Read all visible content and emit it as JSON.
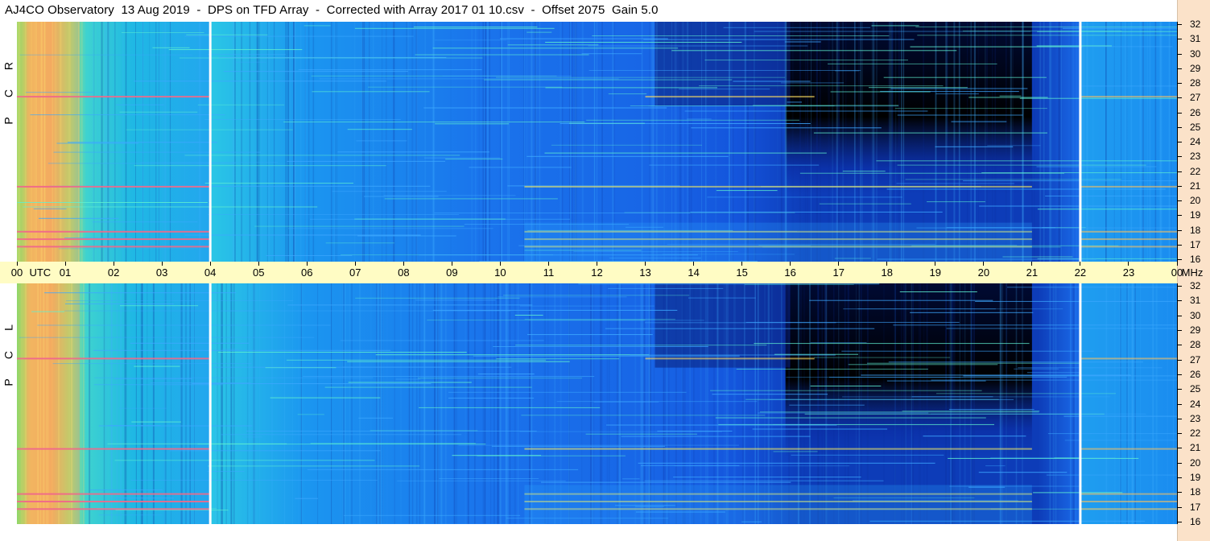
{
  "title": "AJ4CO Observatory  13 Aug 2019  -  DPS on TFD Array  -  Corrected with Array 2017 01 10.csv  -  Offset 2075  Gain 5.0",
  "panels": [
    {
      "id": "rcp",
      "label": "R C P",
      "letters": [
        "R",
        "C",
        "P"
      ]
    },
    {
      "id": "lcp",
      "label": "L C P",
      "letters": [
        "L",
        "C",
        "P"
      ]
    }
  ],
  "time_axis": {
    "labels": [
      "00",
      "01",
      "02",
      "03",
      "04",
      "05",
      "06",
      "07",
      "08",
      "09",
      "10",
      "11",
      "12",
      "13",
      "14",
      "15",
      "16",
      "17",
      "18",
      "19",
      "20",
      "21",
      "22",
      "23",
      "00"
    ],
    "unit_left": "UTC",
    "unit_right": "MHz"
  },
  "freq_axis": {
    "labels": [
      "16",
      "17",
      "18",
      "19",
      "20",
      "21",
      "22",
      "23",
      "24",
      "25",
      "26",
      "27",
      "28",
      "29",
      "30",
      "31",
      "32"
    ]
  },
  "colors": {
    "background": "#ffffff",
    "time_axis_bg": "#fffcc4",
    "right_strip_bg": "#fbe2c9",
    "spectrogram_base": "#1b63e8",
    "quiet_dark": "#000a33",
    "hot": "#f06a8a"
  },
  "chart_data": {
    "type": "heatmap",
    "title": "AJ4CO Observatory  13 Aug 2019  -  DPS on TFD Array  -  Corrected with Array 2017 01 10.csv  -  Offset 2075  Gain 5.0",
    "xlabel": "UTC",
    "ylabel": "MHz",
    "x_range_hours_utc": [
      0,
      24
    ],
    "y_range_mhz": [
      16,
      32
    ],
    "panels": [
      "R C P",
      "L C P"
    ],
    "colormap": "jet-like (dark navy = low, blue, cyan, green, yellow, orange, pink = high)",
    "marker_lines_utc_hours": [
      4,
      22
    ],
    "intensity_regions": [
      {
        "x_hours": [
          0.0,
          1.3
        ],
        "y_mhz": [
          16,
          32
        ],
        "level": "high (yellow/orange)"
      },
      {
        "x_hours": [
          1.3,
          4.0
        ],
        "y_mhz": [
          16,
          32
        ],
        "level": "medium (cyan/green)"
      },
      {
        "x_hours": [
          4.0,
          10.0
        ],
        "y_mhz": [
          16,
          32
        ],
        "level": "medium-low (light blue)"
      },
      {
        "x_hours": [
          10.0,
          16.0
        ],
        "y_mhz": [
          16,
          32
        ],
        "level": "low (blue)"
      },
      {
        "x_hours": [
          16.0,
          21.0
        ],
        "y_mhz": [
          23,
          32
        ],
        "level": "very low (black/navy)"
      },
      {
        "x_hours": [
          21.0,
          22.0
        ],
        "y_mhz": [
          16,
          32
        ],
        "level": "low (blue)"
      },
      {
        "x_hours": [
          22.0,
          24.0
        ],
        "y_mhz": [
          16,
          32
        ],
        "level": "medium (light blue/cyan)"
      }
    ],
    "interference_bands_mhz": [
      17.0,
      17.5,
      18.0,
      21.0,
      27.0
    ]
  }
}
